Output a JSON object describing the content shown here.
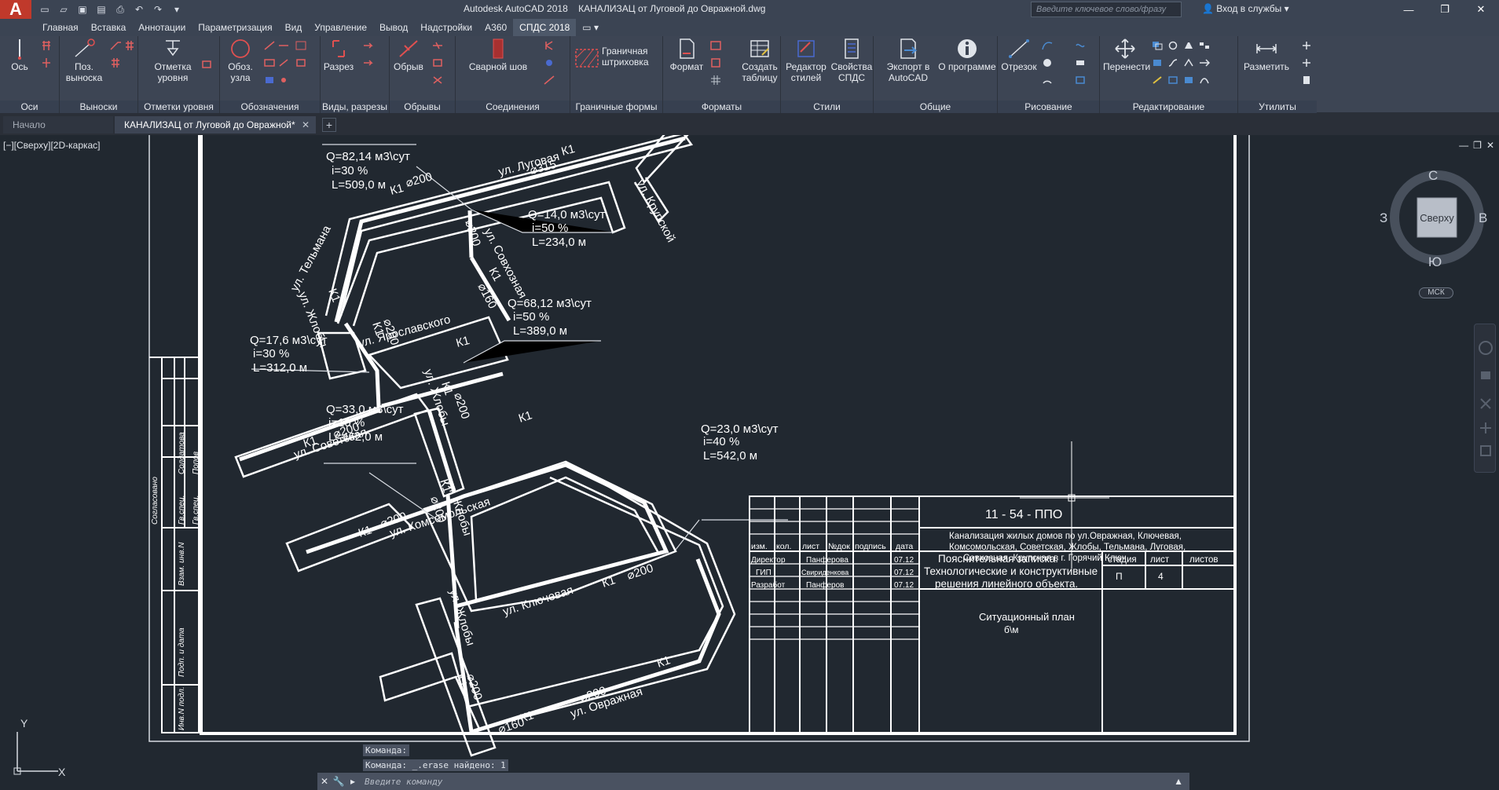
{
  "window": {
    "app_title": "Autodesk AutoCAD 2018    КАНАЛИЗАЦ от Луговой до Овражной.dwg",
    "search_placeholder": "Введите ключевое слово/фразу",
    "login": "Вход в службы"
  },
  "menu": {
    "tabs": [
      "Главная",
      "Вставка",
      "Аннотации",
      "Параметризация",
      "Вид",
      "Управление",
      "Вывод",
      "Надстройки",
      "A360",
      "СПДС 2018"
    ],
    "active": "СПДС 2018"
  },
  "ribbon": {
    "panels": [
      {
        "title": "Оси",
        "buttons": [
          "Ось"
        ]
      },
      {
        "title": "Выноски",
        "buttons": [
          "Поз. выноска"
        ]
      },
      {
        "title": "Отметки уровня",
        "buttons": [
          "Отметка уровня"
        ]
      },
      {
        "title": "Обозначения",
        "buttons": [
          "Обоз. узла"
        ]
      },
      {
        "title": "Виды, разрезы",
        "buttons": [
          "Разрез"
        ]
      },
      {
        "title": "Обрывы",
        "buttons": [
          "Обрыв"
        ]
      },
      {
        "title": "Соединения",
        "buttons": [
          "Сварной шов"
        ]
      },
      {
        "title": "Граничные формы",
        "buttons": [
          "Граничная штриховка"
        ]
      },
      {
        "title": "Форматы",
        "buttons": [
          "Формат",
          "Создать таблицу"
        ]
      },
      {
        "title": "Стили",
        "buttons": [
          "Редактор стилей",
          "Свойства СПДС"
        ]
      },
      {
        "title": "Общие",
        "buttons": [
          "Экспорт в AutoCAD",
          "О программе"
        ]
      },
      {
        "title": "Рисование",
        "buttons": [
          "Отрезок"
        ]
      },
      {
        "title": "Редактирование",
        "buttons": [
          "Перенести"
        ]
      },
      {
        "title": "Утилиты",
        "buttons": [
          "Разметить"
        ]
      }
    ]
  },
  "doc_tabs": {
    "home": "Начало",
    "file": "КАНАЛИЗАЦ от Луговой до Овражной*"
  },
  "viewport": {
    "label": "[−][Сверху][2D-каркас]"
  },
  "viewcube": {
    "north": "С",
    "south": "Ю",
    "east": "В",
    "west": "З",
    "face": "Сверху",
    "ucs_badge": "МСК"
  },
  "drawing": {
    "streets": [
      "ул. Луговая",
      "ул. Крупской",
      "ул. Тельмана",
      "ул. Совхозная",
      "ул. Жлобы",
      "ул. Ярославского",
      "ул. Советская",
      "ул. Комсомольская",
      "ул. Ключевая",
      "ул. Овражная"
    ],
    "callouts": [
      {
        "q": "Q=82,14 м3\\сут",
        "i": "i=30 %",
        "l": "L=509,0 м"
      },
      {
        "q": "Q=14,0 м3\\сут",
        "i": "i=50 %",
        "l": "L=234,0 м"
      },
      {
        "q": "Q=68,12 м3\\сут",
        "i": "i=50 %",
        "l": "L=389,0 м"
      },
      {
        "q": "Q=17,6 м3\\сут",
        "i": "i=30 %",
        "l": "L=312,0 м"
      },
      {
        "q": "Q=33,0 м3\\сут",
        "i": "i=10 %",
        "l": "L=462,0 м"
      },
      {
        "q": "Q=23,0 м3\\сут",
        "i": "i=40 %",
        "l": "L=542,0 м"
      }
    ],
    "pipe_labels": [
      "К1",
      "⌀200",
      "⌀315",
      "⌀160"
    ],
    "side_stamp": [
      "Согласовано",
      "Солдатова",
      "Попов",
      "Гв.спец.",
      "Гв.спец.",
      "Взам. инв.N",
      "Подп. и дата",
      "Инв.N подл."
    ],
    "title_block": {
      "code": "11 - 54 - ППО",
      "object": [
        "Канализация жилых домов по ул.Овражная, Ключевая,",
        "Комсомольская, Советская, Жлобы, Тельмана, Луговая,",
        "Совхозная, Крупская в г. Горячий Ключ."
      ],
      "headers": [
        "изм.",
        "кол.",
        "лист",
        "№док",
        "подпись",
        "дата"
      ],
      "people": [
        {
          "role": "Директор",
          "name": "Панферова",
          "date": "07.12"
        },
        {
          "role": "ГИП",
          "name": "Свириденкова",
          "date": "07.12"
        },
        {
          "role": "Разработ",
          "name": "Панферов",
          "date": "07.12"
        }
      ],
      "doc_title": [
        "Пояснительная записка.",
        "Технологические и конструктивные",
        "решения линейного объекта."
      ],
      "stage_header": "стадия",
      "sheet_header": "лист",
      "sheets_header": "листов",
      "stage": "П",
      "sheet": "4",
      "plan_title": "Ситуационный план",
      "scale": "б\\м"
    }
  },
  "command": {
    "history": [
      "Команда:",
      "Команда:  _.erase найдено: 1"
    ],
    "placeholder": "Введите команду"
  }
}
